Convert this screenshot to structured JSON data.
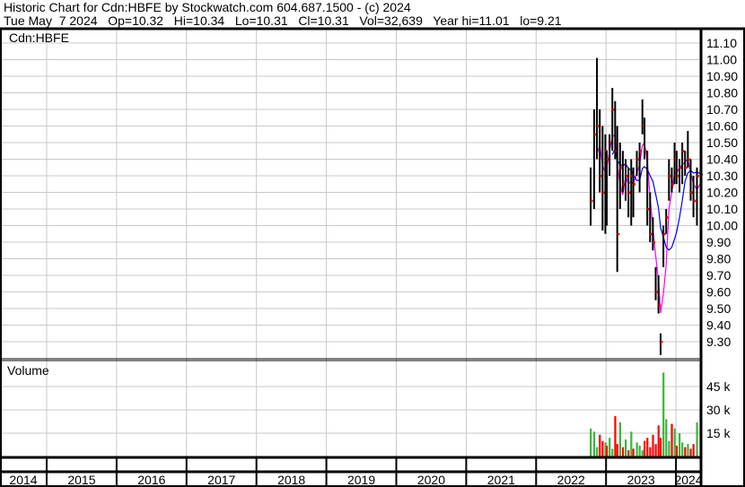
{
  "header": {
    "line1": "Historic Chart for Cdn:HBFE by Stockwatch.com 604.687.1500 - (c) 2024",
    "line2": "Tue May  7 2024   Op=10.32   Hi=10.34   Lo=10.31   Cl=10.31   Vol=32,639   Year hi=11.01   lo=9.21"
  },
  "chart_data": {
    "type": "ohlc",
    "symbol_label": "Cdn:HBFE",
    "volume_label": "Volume",
    "x_axis": {
      "tick_labels": [
        "2014",
        "2015",
        "2016",
        "2017",
        "2018",
        "2019",
        "2020",
        "2021",
        "2022",
        "2023",
        "2024"
      ],
      "range": [
        2014.33,
        2024.37
      ]
    },
    "price_axis": {
      "ticks": [
        "11.10",
        "11.00",
        "10.90",
        "10.80",
        "10.70",
        "10.60",
        "10.50",
        "10.40",
        "10.30",
        "10.20",
        "10.10",
        "10.00",
        "9.90",
        "9.80",
        "9.70",
        "9.60",
        "9.50",
        "9.40",
        "9.30"
      ],
      "range": [
        9.21,
        11.18
      ]
    },
    "volume_axis": {
      "ticks": [
        {
          "v": 15000,
          "label": "15 k"
        },
        {
          "v": 30000,
          "label": "30 k"
        },
        {
          "v": 45000,
          "label": "45 k"
        }
      ],
      "max": 58000
    },
    "moving_averages": [
      {
        "name": "short",
        "period": 3,
        "color": "#ff00ff"
      },
      {
        "name": "long",
        "period": 9,
        "color": "#0000ff"
      }
    ],
    "colors": {
      "bar": "#000000",
      "close": "#ff0000",
      "vol_up": "#3cb43c",
      "vol_down": "#ff0000",
      "grid": "#c8c8c8"
    },
    "points": [
      {
        "t": 2022.78,
        "hi": 10.35,
        "lo": 10.0,
        "cl": 10.15,
        "vol": 18000
      },
      {
        "t": 2022.83,
        "hi": 10.7,
        "lo": 10.1,
        "cl": 10.55,
        "vol": 16000
      },
      {
        "t": 2022.87,
        "hi": 11.01,
        "lo": 10.4,
        "cl": 10.6,
        "vol": 6000
      },
      {
        "t": 2022.91,
        "hi": 10.7,
        "lo": 10.2,
        "cl": 10.3,
        "vol": 14000
      },
      {
        "t": 2022.95,
        "hi": 10.6,
        "lo": 9.97,
        "cl": 10.2,
        "vol": 10000
      },
      {
        "t": 2022.99,
        "hi": 10.55,
        "lo": 9.95,
        "cl": 10.45,
        "vol": 9000
      },
      {
        "t": 2023.01,
        "hi": 10.45,
        "lo": 10.0,
        "cl": 10.4,
        "vol": 7000
      },
      {
        "t": 2023.05,
        "hi": 10.55,
        "lo": 10.3,
        "cl": 10.5,
        "vol": 12000
      },
      {
        "t": 2023.09,
        "hi": 10.83,
        "lo": 10.45,
        "cl": 10.7,
        "vol": 5000
      },
      {
        "t": 2023.13,
        "hi": 10.75,
        "lo": 10.4,
        "cl": 10.45,
        "vol": 26000
      },
      {
        "t": 2023.16,
        "hi": 10.6,
        "lo": 9.72,
        "cl": 9.95,
        "vol": 8000
      },
      {
        "t": 2023.2,
        "hi": 10.5,
        "lo": 10.1,
        "cl": 10.35,
        "vol": 22000
      },
      {
        "t": 2023.24,
        "hi": 10.45,
        "lo": 10.2,
        "cl": 10.25,
        "vol": 6000
      },
      {
        "t": 2023.28,
        "hi": 10.4,
        "lo": 10.15,
        "cl": 10.3,
        "vol": 11000
      },
      {
        "t": 2023.32,
        "hi": 10.35,
        "lo": 10.05,
        "cl": 10.2,
        "vol": 4000
      },
      {
        "t": 2023.36,
        "hi": 10.4,
        "lo": 10.0,
        "cl": 10.3,
        "vol": 16000
      },
      {
        "t": 2023.39,
        "hi": 10.35,
        "lo": 10.05,
        "cl": 10.25,
        "vol": 5000
      },
      {
        "t": 2023.44,
        "hi": 10.45,
        "lo": 10.3,
        "cl": 10.4,
        "vol": 9000
      },
      {
        "t": 2023.48,
        "hi": 10.5,
        "lo": 10.2,
        "cl": 10.45,
        "vol": 7000
      },
      {
        "t": 2023.52,
        "hi": 10.76,
        "lo": 10.55,
        "cl": 10.6,
        "vol": 4000
      },
      {
        "t": 2023.55,
        "hi": 10.65,
        "lo": 10.4,
        "cl": 10.45,
        "vol": 10000
      },
      {
        "t": 2023.59,
        "hi": 10.45,
        "lo": 10.0,
        "cl": 10.1,
        "vol": 12000
      },
      {
        "t": 2023.63,
        "hi": 10.2,
        "lo": 9.9,
        "cl": 9.95,
        "vol": 6000
      },
      {
        "t": 2023.67,
        "hi": 10.05,
        "lo": 9.85,
        "cl": 9.9,
        "vol": 14000
      },
      {
        "t": 2023.71,
        "hi": 9.75,
        "lo": 9.55,
        "cl": 9.6,
        "vol": 8000
      },
      {
        "t": 2023.75,
        "hi": 9.7,
        "lo": 9.47,
        "cl": 9.52,
        "vol": 20000
      },
      {
        "t": 2023.78,
        "hi": 9.35,
        "lo": 9.22,
        "cl": 9.3,
        "vol": 12000
      },
      {
        "t": 2023.82,
        "hi": 10.0,
        "lo": 9.75,
        "cl": 9.95,
        "vol": 54000
      },
      {
        "t": 2023.86,
        "hi": 10.1,
        "lo": 9.95,
        "cl": 10.05,
        "vol": 24000
      },
      {
        "t": 2023.9,
        "hi": 10.4,
        "lo": 10.15,
        "cl": 10.3,
        "vol": 10000
      },
      {
        "t": 2023.94,
        "hi": 10.35,
        "lo": 10.2,
        "cl": 10.25,
        "vol": 21000
      },
      {
        "t": 2023.98,
        "hi": 10.5,
        "lo": 10.25,
        "cl": 10.4,
        "vol": 18000
      },
      {
        "t": 2024.01,
        "hi": 10.45,
        "lo": 10.25,
        "cl": 10.3,
        "vol": 7000
      },
      {
        "t": 2024.05,
        "hi": 10.4,
        "lo": 10.2,
        "cl": 10.35,
        "vol": 15000
      },
      {
        "t": 2024.09,
        "hi": 10.5,
        "lo": 10.25,
        "cl": 10.45,
        "vol": 9000
      },
      {
        "t": 2024.13,
        "hi": 10.45,
        "lo": 10.3,
        "cl": 10.35,
        "vol": 6000
      },
      {
        "t": 2024.17,
        "hi": 10.57,
        "lo": 10.35,
        "cl": 10.4,
        "vol": 8000
      },
      {
        "t": 2024.21,
        "hi": 10.4,
        "lo": 10.15,
        "cl": 10.2,
        "vol": 5000
      },
      {
        "t": 2024.25,
        "hi": 10.3,
        "lo": 10.05,
        "cl": 10.15,
        "vol": 8000
      },
      {
        "t": 2024.3,
        "hi": 10.35,
        "lo": 10.0,
        "cl": 10.3,
        "vol": 22000
      },
      {
        "t": 2024.35,
        "hi": 10.34,
        "lo": 10.31,
        "cl": 10.31,
        "vol": 32639
      }
    ]
  }
}
